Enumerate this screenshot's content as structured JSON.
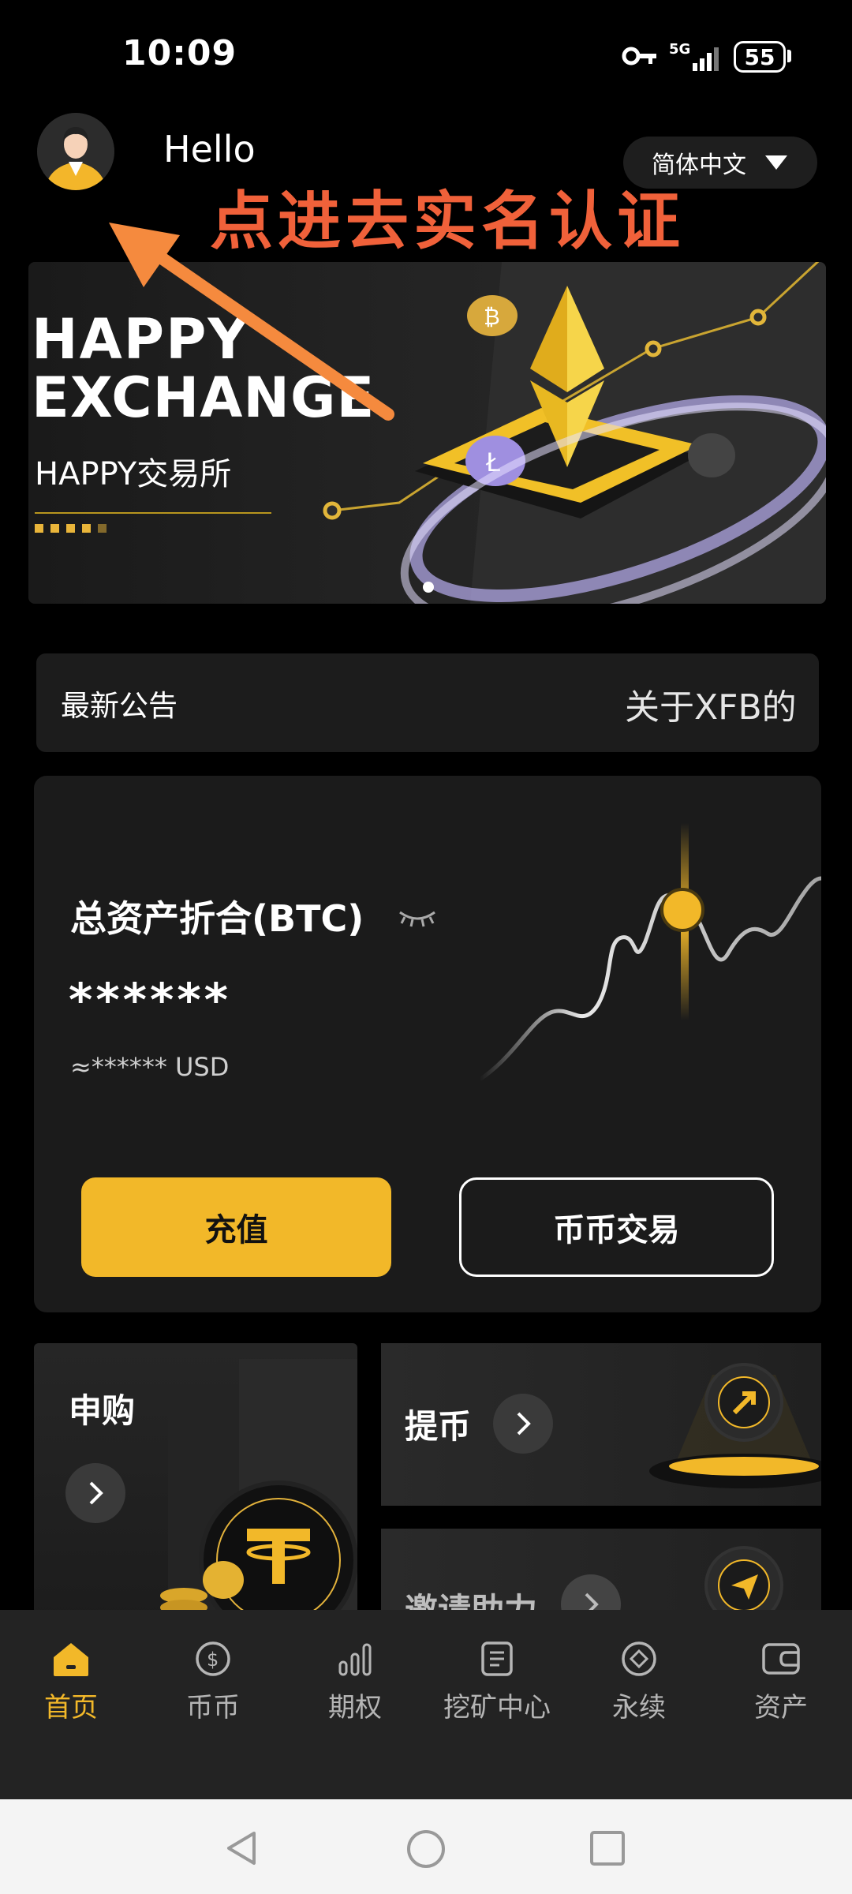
{
  "status_bar": {
    "time": "10:09",
    "network": "5G",
    "battery": "55"
  },
  "header": {
    "greeting": "Hello",
    "language": "简体中文"
  },
  "annotation": {
    "text": "点进去实名认证"
  },
  "banner": {
    "title_line1": "HAPPY",
    "title_line2": "EXCHANGE",
    "subtitle": "HAPPY交易所"
  },
  "notice": {
    "label": "最新公告",
    "text": "关于XFB的"
  },
  "asset": {
    "title": "总资产折合(BTC)",
    "value": "******",
    "usd": "≈****** USD",
    "deposit": "充值",
    "trade": "币币交易"
  },
  "tiles": {
    "subscribe": "申购",
    "withdraw": "提币",
    "invite": "邀请助力"
  },
  "nav": {
    "items": [
      {
        "label": "首页",
        "icon": "home-icon",
        "active": true
      },
      {
        "label": "币币",
        "icon": "dollar-coin-icon"
      },
      {
        "label": "期权",
        "icon": "bar-chart-icon"
      },
      {
        "label": "挖矿中心",
        "icon": "document-icon"
      },
      {
        "label": "永续",
        "icon": "diamond-icon"
      },
      {
        "label": "资产",
        "icon": "wallet-icon"
      }
    ]
  },
  "colors": {
    "accent": "#f2b829",
    "annotation": "#f0613a",
    "background": "#000000"
  }
}
